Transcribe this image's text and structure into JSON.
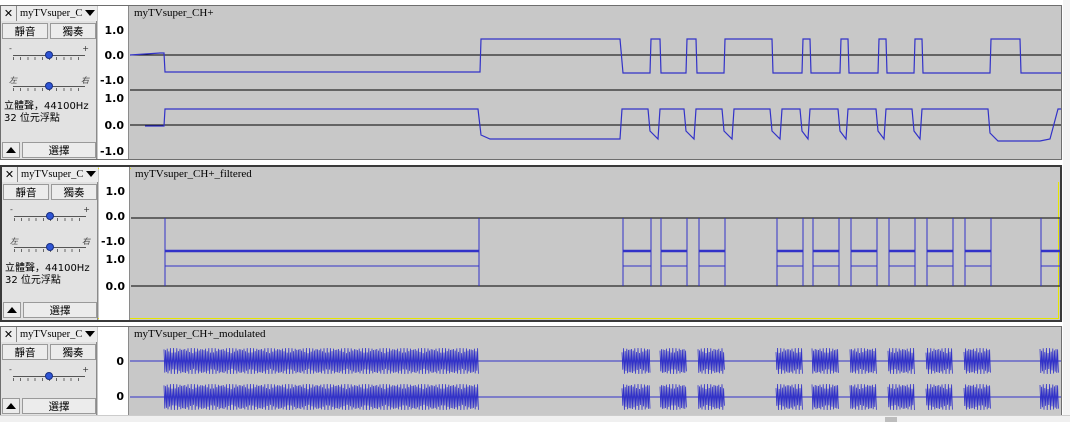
{
  "tracks": [
    {
      "id": "t1",
      "name": "myTVsuper_C",
      "title": "myTVsuper_CH+",
      "close_glyph": "✕",
      "mute_label": "靜音",
      "solo_label": "獨奏",
      "gain_minus": "-",
      "gain_plus": "+",
      "pan_left": "左",
      "pan_right": "右",
      "info_line1": "立體聲，44100Hz",
      "info_line2": "32 位元浮點",
      "select_label": "選擇",
      "channels": [
        {
          "scale_top": "1.0",
          "scale_mid": "0.0",
          "scale_bot": "-1.0"
        },
        {
          "scale_top": "1.0",
          "scale_mid": "0.0",
          "scale_bot": "-1.0"
        }
      ]
    },
    {
      "id": "t2",
      "name": "myTVsuper_C",
      "title": "myTVsuper_CH+_filtered",
      "close_glyph": "✕",
      "mute_label": "靜音",
      "solo_label": "獨奏",
      "gain_minus": "-",
      "gain_plus": "+",
      "pan_left": "左",
      "pan_right": "右",
      "info_line1": "立體聲，44100Hz",
      "info_line2": "32 位元浮點",
      "select_label": "選擇",
      "channels": [
        {
          "scale_top": "1.0",
          "scale_mid": "0.0",
          "scale_bot": "-1.0"
        },
        {
          "scale_top": "1.0",
          "scale_mid": "0.0",
          "scale_bot": ""
        }
      ]
    },
    {
      "id": "t3",
      "name": "myTVsuper_C",
      "title": "myTVsuper_CH+_modulated",
      "close_glyph": "✕",
      "mute_label": "靜音",
      "solo_label": "獨奏",
      "gain_minus": "-",
      "gain_plus": "+",
      "select_label": "選擇",
      "channels": [
        {
          "scale_mid": "0"
        },
        {
          "scale_mid": "0"
        }
      ]
    }
  ],
  "colors": {
    "waveform": "#3232c8",
    "waveform_bg": "#c8c8c8",
    "track_bg": "#e2e2e2",
    "selected_border": "#e6e600",
    "knob": "#2f55d6"
  }
}
